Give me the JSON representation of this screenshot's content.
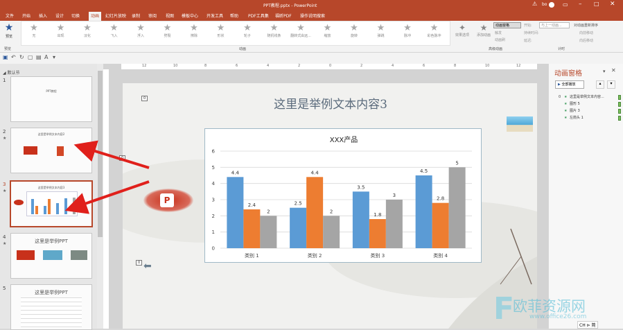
{
  "title": "PPT教程.pptx  -  PowerPoint",
  "user": "bo",
  "tabs": [
    "文件",
    "开始",
    "插入",
    "设计",
    "切换",
    "动画",
    "幻灯片放映",
    "录制",
    "审阅",
    "视图",
    "模板中心",
    "开发工具",
    "帮助",
    "PDF工具集",
    "福昕PDF",
    "操作说明搜索"
  ],
  "active_tab": "动画",
  "ribbon": {
    "preview": "预览",
    "effects": [
      "无",
      "出现",
      "淡化",
      "飞入",
      "浮入",
      "劈裂",
      "擦除",
      "形状",
      "轮子",
      "随机线条",
      "翻转式由远...",
      "缩放",
      "旋转",
      "弹跳",
      "脉冲",
      "彩色脉冲"
    ],
    "effect_options": "效果选项",
    "add_animation": "添加动画",
    "animation_pane": "动画窗格",
    "trigger": "触发",
    "animation_painter": "动画刷",
    "start_label": "开始:",
    "start_value": "与上一动画...",
    "duration_label": "持续时间:",
    "delay_label": "延迟:",
    "reorder": "对动画重新排序",
    "move_earlier": "向前移动",
    "move_later": "向后移动",
    "groups": {
      "preview": "预览",
      "animation": "动画",
      "advanced": "高级动画",
      "timing": "计时"
    }
  },
  "section": "默认节",
  "slides": [
    {
      "num": "1",
      "title": "PPT教程"
    },
    {
      "num": "2",
      "title": "这里是举例文本内容2"
    },
    {
      "num": "3",
      "title": "这里是举例文本内容3"
    },
    {
      "num": "4",
      "title": "这里是举例PPT"
    },
    {
      "num": "5",
      "title": "这里是举例PPT"
    }
  ],
  "ruler_ticks": [
    "12",
    "10",
    "8",
    "6",
    "4",
    "2",
    "0",
    "2",
    "4",
    "6",
    "8",
    "10",
    "12"
  ],
  "slide": {
    "heading": "这里是举例文本内容3",
    "badges": [
      "0",
      "0",
      "0"
    ]
  },
  "chart_data": {
    "type": "bar",
    "title": "XXX产品",
    "categories": [
      "类别 1",
      "类别 2",
      "类别 3",
      "类别 4"
    ],
    "series": [
      {
        "color": "#5b9bd5",
        "values": [
          4.4,
          2.5,
          3.5,
          4.5
        ]
      },
      {
        "color": "#ed7d31",
        "values": [
          2.4,
          4.4,
          1.8,
          2.8
        ]
      },
      {
        "color": "#a5a5a5",
        "values": [
          2,
          2,
          3,
          5
        ]
      }
    ],
    "yticks": [
      "0",
      "1",
      "2",
      "3",
      "4",
      "5",
      "6"
    ],
    "ylim": [
      0,
      6
    ],
    "grid": true
  },
  "anim_pane": {
    "title": "动画窗格",
    "play_all": "全部播放",
    "items": [
      {
        "num": "0",
        "label": "这里是举例文本内容..."
      },
      {
        "num": "",
        "label": "图形 5"
      },
      {
        "num": "",
        "label": "图片 3"
      },
      {
        "num": "",
        "label": "左箭头 1"
      }
    ]
  },
  "status": {
    "ime": "CH ⊳ 简"
  },
  "watermark": {
    "text": "欧菲资源网",
    "url": "www.office26.com"
  }
}
